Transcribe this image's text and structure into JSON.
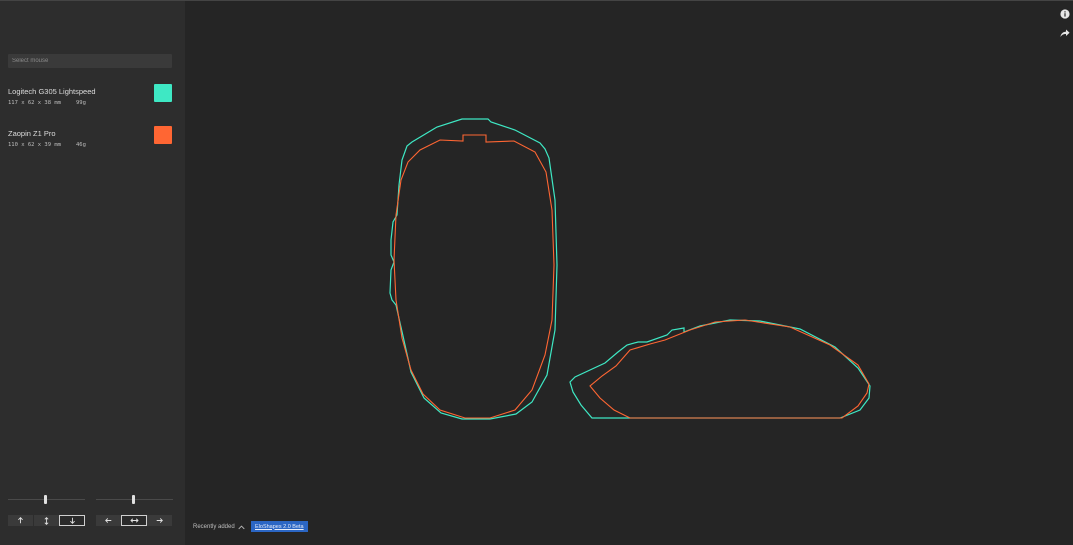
{
  "search": {
    "placeholder": "Select mouse"
  },
  "mice": [
    {
      "name": "Logitech G305 Lightspeed",
      "dims": "117 x 62 x 38 mm",
      "weight": "99g",
      "color": "#3ee8c4"
    },
    {
      "name": "Zaopin Z1 Pro",
      "dims": "110 x 62 x 39 mm",
      "weight": "46g",
      "color": "#ff6633"
    }
  ],
  "controls": {
    "up_icon": "arrow-up-icon",
    "vertical_icon": "arrows-vertical-icon",
    "down_icon": "arrow-down-icon",
    "left_icon": "arrow-left-icon",
    "horizontal_icon": "arrows-horizontal-icon",
    "right_icon": "arrow-right-icon"
  },
  "sliders": {
    "left_level": 0.49,
    "right_level": 0.49
  },
  "footer": {
    "recent_label": "Recently added",
    "version_label": "EloShapes 2.0 Beta"
  },
  "icons": {
    "info": "info-icon",
    "share": "share-icon"
  },
  "colors": {
    "background": "#252525",
    "sidebar": "#2d2d2d",
    "accent": "#2b66c4"
  }
}
